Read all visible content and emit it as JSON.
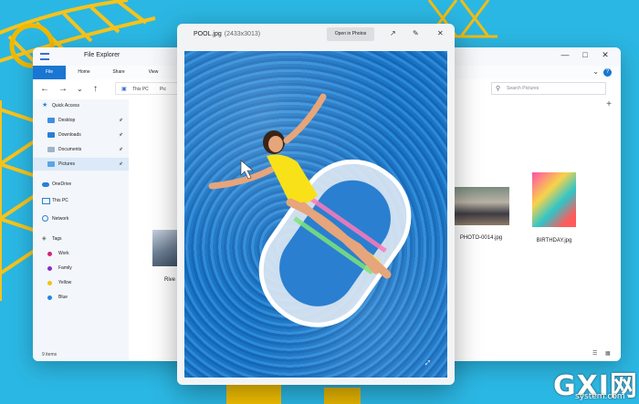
{
  "explorer": {
    "title": "File Explorer",
    "ribbon_tabs": [
      "File",
      "Home",
      "Share",
      "View"
    ],
    "address": {
      "segments": [
        "This PC",
        "Pic"
      ]
    },
    "search_placeholder": "Search Pictures",
    "sidebar": {
      "quick_access": "Quick Access",
      "pinned": [
        "Desktop",
        "Downloads",
        "Documents",
        "Pictures"
      ],
      "onedrive": "OneDrive",
      "this_pc": "This PC",
      "network": "Network",
      "tags": "Tags",
      "tag_items": [
        {
          "label": "Work",
          "color": "#d0247b"
        },
        {
          "label": "Family",
          "color": "#8e2bc4"
        },
        {
          "label": "Yellow",
          "color": "#f1c40f"
        },
        {
          "label": "Blue",
          "color": "#1e88e5"
        }
      ]
    },
    "status": "9 items",
    "files": [
      {
        "label": "Rive"
      },
      {
        "label": "PHOTO-0014.jpg"
      },
      {
        "label": "BIRTHDAY.jpg"
      }
    ]
  },
  "viewer": {
    "filename": "POOL.jpg",
    "dimensions": "(2433x3013)",
    "open_button": "Open in Photos"
  },
  "watermark": {
    "big": "GXI网",
    "sub": "system.com"
  },
  "colors": {
    "accent": "#1976d2",
    "sky": "#2bb7e3",
    "crane": "#f3c000"
  }
}
